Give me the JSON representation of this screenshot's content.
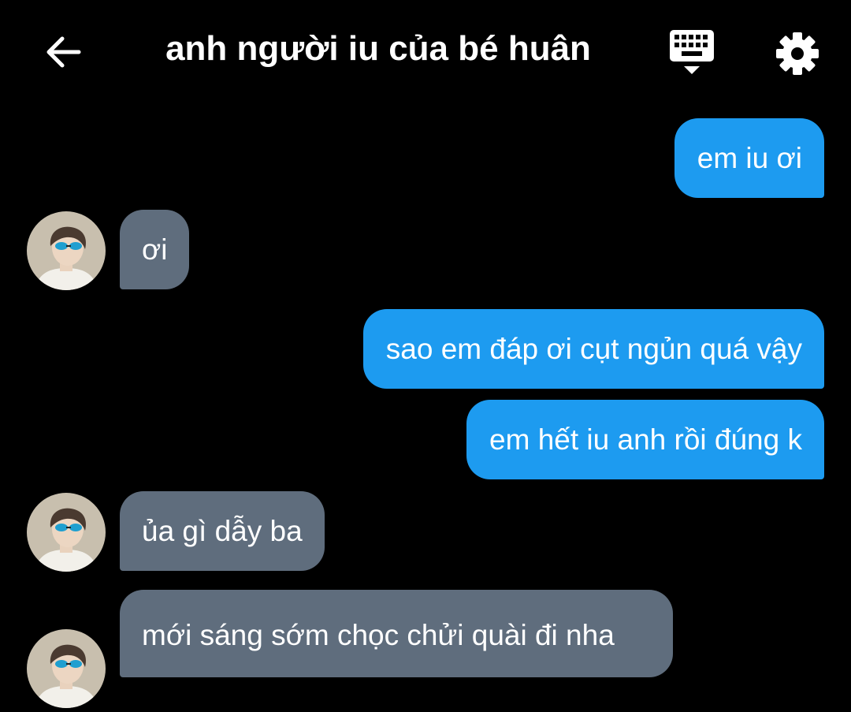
{
  "header": {
    "title": "anh người iu của bé huân",
    "back_icon": "arrow-left-icon",
    "keyboard_icon": "keyboard-icon",
    "settings_icon": "gear-icon"
  },
  "colors": {
    "background": "#000000",
    "sent_bubble": "#1d9bf0",
    "received_bubble": "#5f6d7d",
    "text": "#ffffff"
  },
  "messages": [
    {
      "sender": "me",
      "text": "em iu ơi"
    },
    {
      "sender": "them",
      "text": "ơi"
    },
    {
      "sender": "me",
      "text": "sao em đáp ơi cụt ngủn quá vậy"
    },
    {
      "sender": "me",
      "text": "em hết iu anh rồi đúng k"
    },
    {
      "sender": "them",
      "text": "ủa gì dẫy ba"
    },
    {
      "sender": "them",
      "text": "mới sáng sớm chọc chửi quài đi nha"
    }
  ]
}
